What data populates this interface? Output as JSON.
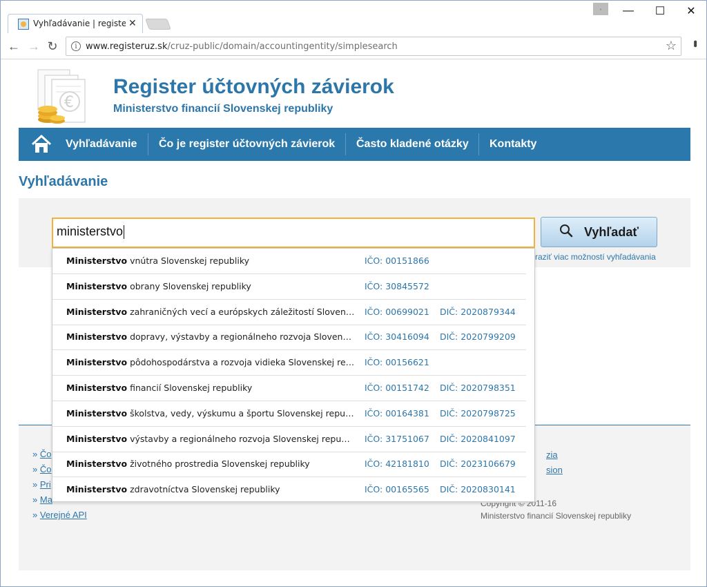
{
  "browser": {
    "tab_title": "Vyhľadávanie | registeruz",
    "tab_close": "✕",
    "url_domain": "www.registeruz.sk",
    "url_path": "/cruz-public/domain/accountingentity/simplesearch",
    "info_glyph": "i",
    "star_glyph": "☆",
    "menu_glyph": "•••",
    "back_glyph": "←",
    "forward_glyph": "→",
    "reload_glyph": "↻",
    "minimize_glyph": "—",
    "maximize_glyph": "☐",
    "close_glyph": "✕",
    "small_glyph": "◦"
  },
  "header": {
    "title": "Register účtovných závierok",
    "subtitle": "Ministerstvo financií Slovenskej republiky"
  },
  "nav": {
    "items": [
      {
        "label": "Vyhľadávanie"
      },
      {
        "label": "Čo je register účtovných závierok"
      },
      {
        "label": "Často kladené otázky"
      },
      {
        "label": "Kontakty"
      }
    ]
  },
  "main": {
    "heading": "Vyhľadávanie",
    "search_value": "ministerstvo",
    "search_button": "Vyhľadať",
    "more_options": "raziť viac možností vyhľadávania"
  },
  "suggestions": [
    {
      "bold": "Ministerstvo",
      "rest": " vnútra Slovenskej republiky",
      "ico": "IČO: 00151866",
      "dic": ""
    },
    {
      "bold": "Ministerstvo",
      "rest": " obrany Slovenskej republiky",
      "ico": "IČO: 30845572",
      "dic": ""
    },
    {
      "bold": "Ministerstvo",
      "rest": " zahraničných vecí a európskych záležitostí Slovenskej …",
      "ico": "IČO: 00699021",
      "dic": "DIČ: 2020879344"
    },
    {
      "bold": "Ministerstvo",
      "rest": " dopravy, výstavby a regionálneho rozvoja Slovenskej r…",
      "ico": "IČO: 30416094",
      "dic": "DIČ: 2020799209"
    },
    {
      "bold": "Ministerstvo",
      "rest": " pôdohospodárstva a rozvoja vidieka Slovenskej republi…",
      "ico": "IČO: 00156621",
      "dic": ""
    },
    {
      "bold": "Ministerstvo",
      "rest": " financií Slovenskej republiky",
      "ico": "IČO: 00151742",
      "dic": "DIČ: 2020798351"
    },
    {
      "bold": "Ministerstvo",
      "rest": " školstva, vedy, výskumu a športu Slovenskej republiky",
      "ico": "IČO: 00164381",
      "dic": "DIČ: 2020798725"
    },
    {
      "bold": "Ministerstvo",
      "rest": " výstavby a regionálneho rozvoja Slovenskej republiky",
      "ico": "IČO: 31751067",
      "dic": "DIČ: 2020841097"
    },
    {
      "bold": "Ministerstvo",
      "rest": " životného prostredia Slovenskej republiky",
      "ico": "IČO: 42181810",
      "dic": "DIČ: 2023106679"
    },
    {
      "bold": "Ministerstvo",
      "rest": " zdravotníctva Slovenskej republiky",
      "ico": "IČO: 00165565",
      "dic": "DIČ: 2020830141"
    }
  ],
  "footer": {
    "left_links": [
      "Čo",
      "Čo",
      "Pri",
      "Ma",
      "Verejné API"
    ],
    "bullet": "»",
    "right_links": [
      "zia",
      "sion"
    ],
    "copyright": "Copyright © 2011-16",
    "org": "Ministerstvo financií Slovenskej republiky"
  },
  "colors": {
    "brand_blue": "#2d76aa",
    "nav_blue": "#2a78ac",
    "focus_orange": "#f0b23c"
  },
  "icons": {
    "home": "home-icon",
    "search": "magnifier-icon",
    "logo": "documents-euro-coins-logo"
  }
}
